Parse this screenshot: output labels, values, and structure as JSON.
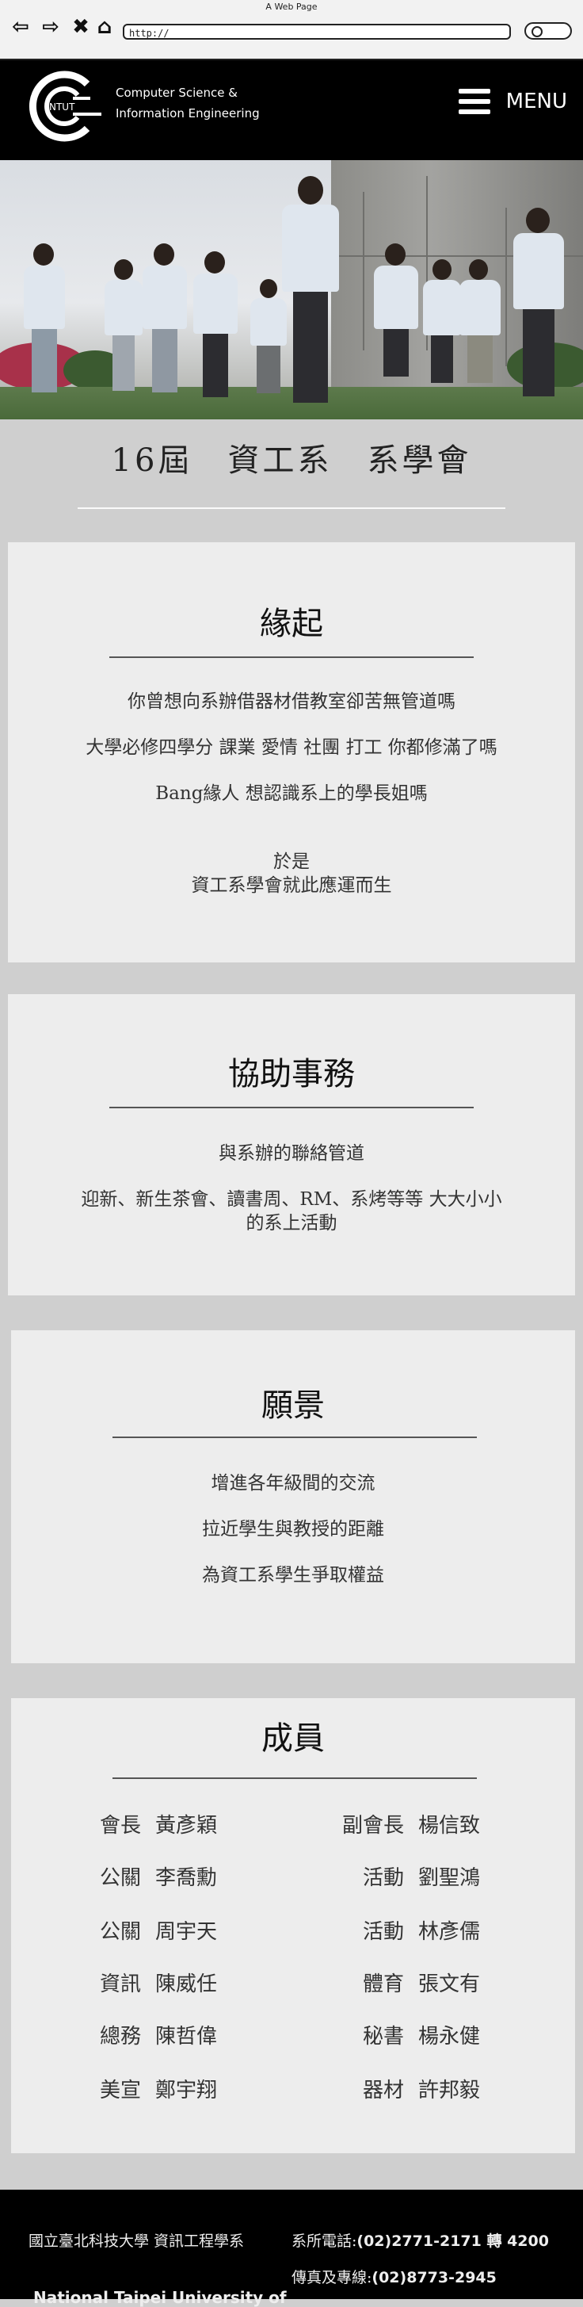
{
  "browser": {
    "window_title": "A Web Page",
    "url": "http://"
  },
  "header": {
    "logo_text": "NTUT",
    "brand_line1": "Computer Science &",
    "brand_line2": "Information Engineering",
    "menu_label": "MENU"
  },
  "page_title": "16屆　資工系　系學會",
  "sections": {
    "origin": {
      "heading": "緣起",
      "lines": [
        "你曾想向系辦借器材借教室卻苦無管道嗎",
        "大學必修四學分 課業 愛情 社團 打工 你都修滿了嗎",
        "Bang緣人 想認識系上的學長姐嗎",
        "於是",
        "資工系學會就此應運而生"
      ]
    },
    "affairs": {
      "heading": "協助事務",
      "lines": [
        "與系辦的聯絡管道",
        "迎新、新生茶會、讀書周、RM、系烤等等 大大小小",
        "的系上活動"
      ]
    },
    "vision": {
      "heading": "願景",
      "lines": [
        "增進各年級間的交流",
        "拉近學生與教授的距離",
        "為資工系學生爭取權益"
      ]
    },
    "members": {
      "heading": "成員",
      "rows": [
        {
          "left_role": "會長",
          "left_name": "黃彥穎",
          "right_role": "副會長",
          "right_name": "楊信致"
        },
        {
          "left_role": "公關",
          "left_name": "李喬勳",
          "right_role": "活動",
          "right_name": "劉聖鴻"
        },
        {
          "left_role": "公關",
          "left_name": "周宇天",
          "right_role": "活動",
          "right_name": "林彥儒"
        },
        {
          "left_role": "資訊",
          "left_name": "陳威任",
          "right_role": "體育",
          "right_name": "張文有"
        },
        {
          "left_role": "總務",
          "left_name": "陳哲偉",
          "right_role": "秘書",
          "right_name": "楊永健"
        },
        {
          "left_role": "美宣",
          "left_name": "鄭宇翔",
          "right_role": "器材",
          "right_name": "許邦毅"
        }
      ]
    }
  },
  "footer": {
    "department": "國立臺北科技大學 資訊工程學系",
    "phone_label": "系所電話:",
    "phone_value": "(02)2771-2171 轉 4200",
    "fax_label": "傳真及專線:",
    "fax_value": "(02)8773-2945",
    "university_en": "National Taipei University of"
  }
}
